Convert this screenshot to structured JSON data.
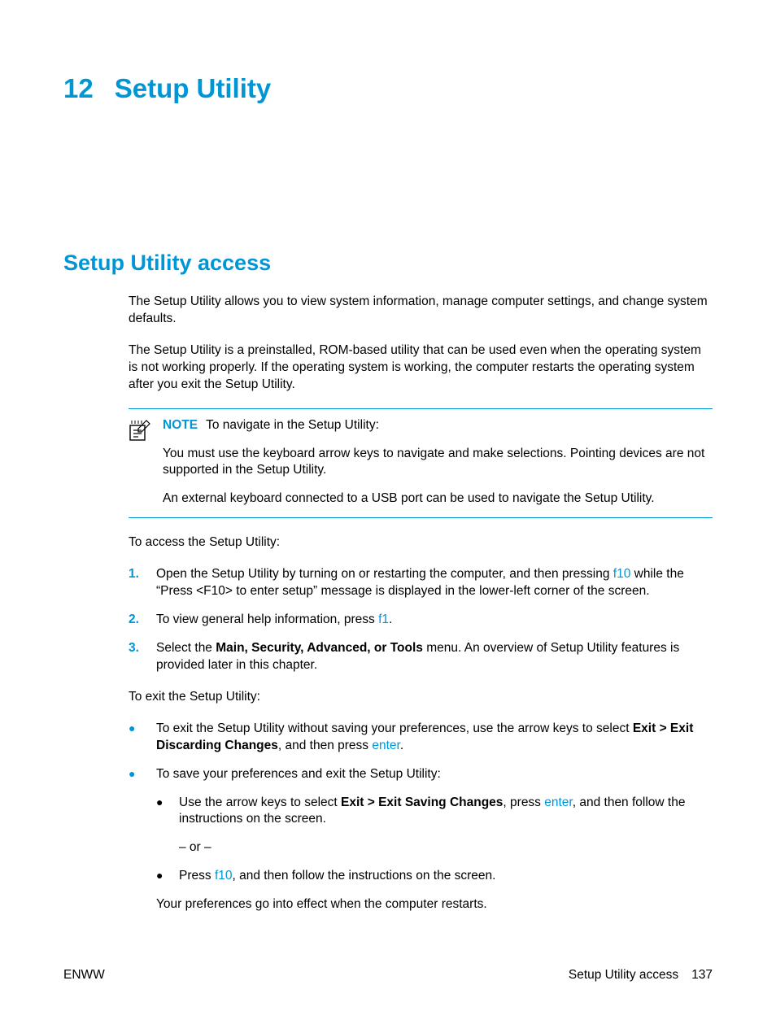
{
  "chapter": {
    "number": "12",
    "title": "Setup Utility"
  },
  "section": {
    "title": "Setup Utility access"
  },
  "intro": {
    "p1": "The Setup Utility allows you to view system information, manage computer settings, and change system defaults.",
    "p2": "The Setup Utility is a preinstalled, ROM-based utility that can be used even when the operating system is not working properly. If the operating system is working, the computer restarts the operating system after you exit the Setup Utility."
  },
  "note": {
    "label": "NOTE",
    "lead": "To navigate in the Setup Utility:",
    "p1": "You must use the keyboard arrow keys to navigate and make selections. Pointing devices are not supported in the Setup Utility.",
    "p2": "An external keyboard connected to a USB port can be used to navigate the Setup Utility."
  },
  "access_lead": "To access the Setup Utility:",
  "steps": {
    "s1": {
      "num": "1.",
      "a": "Open the Setup Utility by turning on or restarting the computer, and then pressing ",
      "key": "f10",
      "b": " while the “Press <F10> to enter setup” message is displayed in the lower-left corner of the screen."
    },
    "s2": {
      "num": "2.",
      "a": "To view general help information, press ",
      "key": "f1",
      "b": "."
    },
    "s3": {
      "num": "3.",
      "a": "Select the ",
      "bold": "Main, Security, Advanced, or Tools",
      "b": " menu. An overview of Setup Utility features is provided later in this chapter."
    }
  },
  "exit_lead": "To exit the Setup Utility:",
  "exit": {
    "b1": {
      "a": "To exit the Setup Utility without saving your preferences, use the arrow keys to select ",
      "bold": "Exit > Exit Discarding Changes",
      "b": ", and then press ",
      "key": "enter",
      "c": "."
    },
    "b2_lead": "To save your preferences and exit the Setup Utility:",
    "sub1": {
      "a": "Use the arrow keys to select ",
      "bold": "Exit > Exit Saving Changes",
      "b": ", press ",
      "key": "enter",
      "c": ", and then follow the instructions on the screen."
    },
    "or": "– or –",
    "sub2": {
      "a": "Press ",
      "key": "f10",
      "b": ", and then follow the instructions on the screen."
    },
    "final": "Your preferences go into effect when the computer restarts."
  },
  "footer": {
    "left": "ENWW",
    "right": "Setup Utility access",
    "page": "137"
  }
}
